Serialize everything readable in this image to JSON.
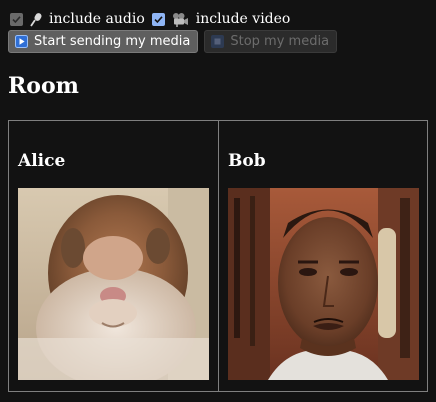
{
  "media_controls": {
    "include_audio": {
      "label": "include audio",
      "checked": true,
      "disabled": true,
      "icon": "microphone-icon"
    },
    "include_video": {
      "label": "include video",
      "checked": true,
      "disabled": false,
      "icon": "video-camera-icon"
    }
  },
  "buttons": {
    "start": {
      "label": "Start sending my media",
      "icon": "play-icon",
      "enabled": true
    },
    "stop": {
      "label": "Stop my media",
      "icon": "stop-icon",
      "enabled": false
    }
  },
  "room": {
    "title": "Room",
    "participants": [
      {
        "name": "Alice",
        "video": "hamster webcam feed"
      },
      {
        "name": "Bob",
        "video": "man webcam feed"
      }
    ]
  },
  "colors": {
    "background": "#121212",
    "checkbox_accent": "#8fb5f5",
    "play_icon_blue": "#2f6fd6",
    "border": "#7f7f7f"
  }
}
